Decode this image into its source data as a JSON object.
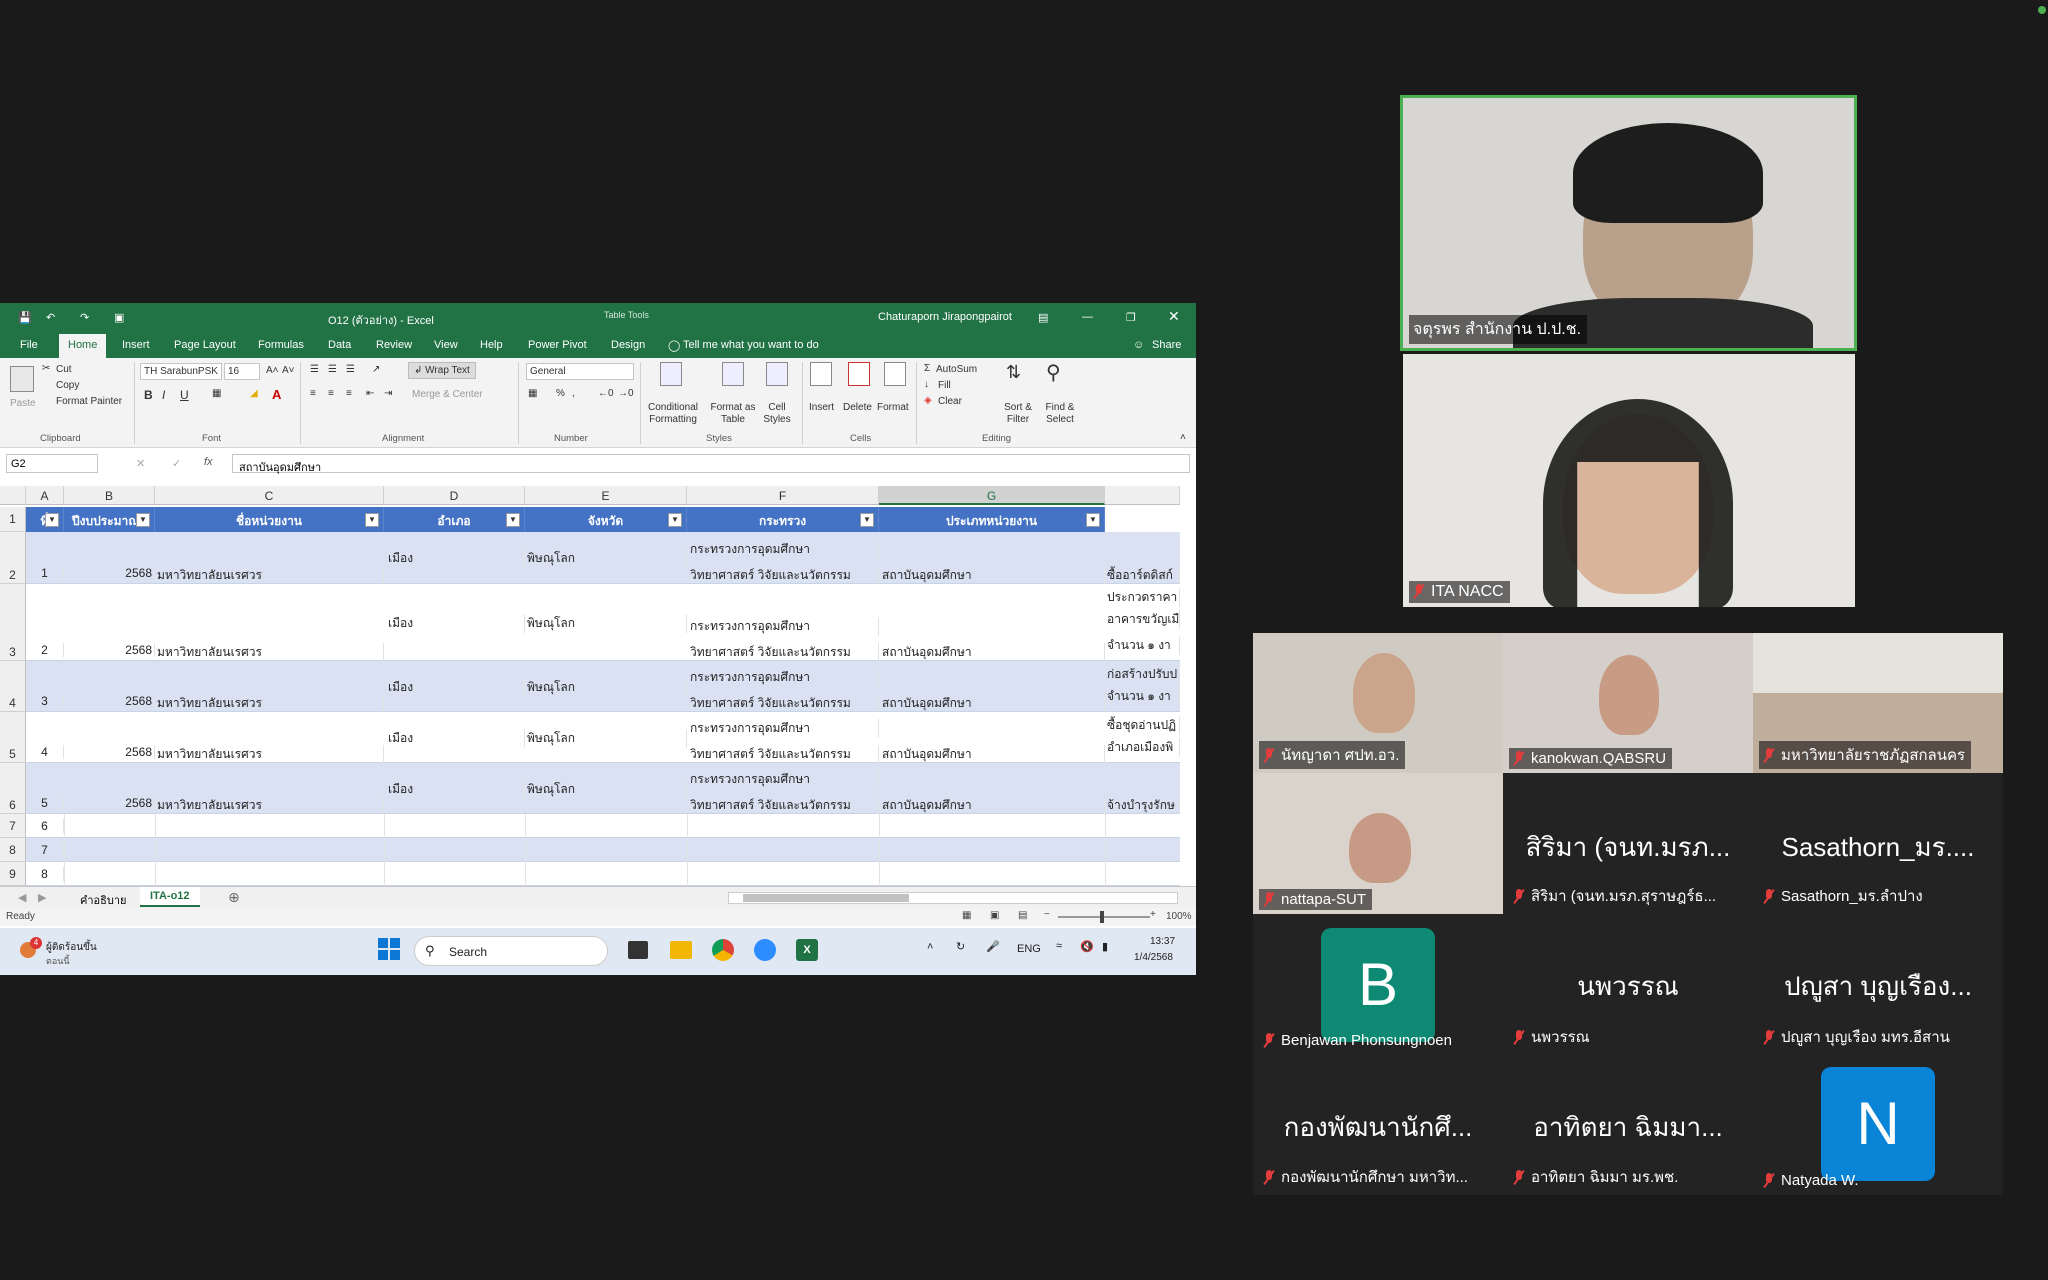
{
  "excel": {
    "title": "O12 (ตัวอย่าง) - Excel",
    "table_tools": "Table Tools",
    "user": "Chaturaporn Jirapongpairot",
    "tabs": [
      "File",
      "Home",
      "Insert",
      "Page Layout",
      "Formulas",
      "Data",
      "Review",
      "View",
      "Help",
      "Power Pivot",
      "Design"
    ],
    "tell_me": "Tell me what you want to do",
    "share": "Share",
    "ribbon": {
      "paste": "Paste",
      "cut": "Cut",
      "copy": "Copy",
      "format_painter": "Format Painter",
      "clipboard": "Clipboard",
      "font_name": "TH SarabunPSK",
      "font_size": "16",
      "font": "Font",
      "wrap_text": "Wrap Text",
      "merge_center": "Merge & Center",
      "alignment": "Alignment",
      "number_format": "General",
      "number": "Number",
      "conditional_formatting": "Conditional Formatting",
      "format_as_table": "Format as Table",
      "cell_styles": "Cell Styles",
      "styles": "Styles",
      "insert": "Insert",
      "delete": "Delete",
      "format": "Format",
      "cells": "Cells",
      "autosum": "AutoSum",
      "fill": "Fill",
      "clear": "Clear",
      "sort_filter": "Sort & Filter",
      "find_select": "Find & Select",
      "editing": "Editing"
    },
    "name_box": "G2",
    "formula": "สถาบันอุดมศึกษา",
    "columns": [
      "A",
      "B",
      "C",
      "D",
      "E",
      "F",
      "G"
    ],
    "headers": [
      "ที่",
      "ปีงบประมาณ",
      "ชื่อหน่วยงาน",
      "อำเภอ",
      "จังหวัด",
      "กระทรวง",
      "ประเภทหน่วยงาน"
    ],
    "rows": [
      {
        "rownum": "2",
        "no": "1",
        "year": "2568",
        "org": "มหาวิทยาลัยนเรศวร",
        "district": "เมือง",
        "province": "พิษณุโลก",
        "ministry1": "กระทรวงการอุดมศึกษา",
        "ministry2": "วิทยาศาสตร์ วิจัยและนวัตกรรม",
        "type": "สถาบันอุดมศึกษา",
        "h1": "ซื้ออาร์ตดิสก์",
        "h2": ""
      },
      {
        "rownum": "3",
        "no": "2",
        "year": "2568",
        "org": "มหาวิทยาลัยนเรศวร",
        "district": "เมือง",
        "province": "พิษณุโลก",
        "ministry1": "กระทรวงการอุดมศึกษา",
        "ministry2": "วิทยาศาสตร์ วิจัยและนวัตกรรม",
        "type": "สถาบันอุดมศึกษา",
        "h1": "ประกวดราคา",
        "h2": "อาคารขวัญเมื"
      },
      {
        "rownum": "4",
        "no": "3",
        "year": "2568",
        "org": "มหาวิทยาลัยนเรศวร",
        "district": "เมือง",
        "province": "พิษณุโลก",
        "ministry1": "กระทรวงการอุดมศึกษา",
        "ministry2": "วิทยาศาสตร์ วิจัยและนวัตกรรม",
        "type": "สถาบันอุดมศึกษา",
        "h1": "ก่อสร้างปรับป",
        "h2": "จำนวน ๑ งา"
      },
      {
        "rownum": "5",
        "no": "4",
        "year": "2568",
        "org": "มหาวิทยาลัยนเรศวร",
        "district": "เมือง",
        "province": "พิษณุโลก",
        "ministry1": "กระทรวงการอุดมศึกษา",
        "ministry2": "วิทยาศาสตร์ วิจัยและนวัตกรรม",
        "type": "สถาบันอุดมศึกษา",
        "h1": "ซื้อชุดอ่านปฏิ",
        "h2": "อำเภอเมืองพิ"
      },
      {
        "rownum": "6",
        "no": "5",
        "year": "2568",
        "org": "มหาวิทยาลัยนเรศวร",
        "district": "เมือง",
        "province": "พิษณุโลก",
        "ministry1": "กระทรวงการอุดมศึกษา",
        "ministry2": "วิทยาศาสตร์ วิจัยและนวัตกรรม",
        "type": "สถาบันอุดมศึกษา",
        "h1": "จ้างบำรุงรักษ",
        "h2": ""
      }
    ],
    "row3_extra": "จำนวน ๑ งา",
    "empty_rows": [
      {
        "rownum": "7",
        "no": "6"
      },
      {
        "rownum": "8",
        "no": "7"
      },
      {
        "rownum": "9",
        "no": "8"
      }
    ],
    "sheets": [
      "คำอธิบาย",
      "ITA-o12"
    ],
    "active_sheet": "ITA-o12",
    "status": "Ready",
    "zoom": "100%",
    "taskbar": {
      "weather": "ผู้ติดร้อนขึ้น",
      "weather_sub": "ตอนนี้",
      "weather_badge": "4",
      "search": "Search",
      "lang": "ENG",
      "time": "13:37",
      "date": "1/4/2568"
    }
  },
  "participants": [
    {
      "name": "จตุรพร สำนักงาน ป.ป.ช.",
      "muted": false,
      "active": true
    },
    {
      "name": "ITA NACC",
      "muted": true
    },
    {
      "name": "นัทญาดา ศปท.อว.",
      "muted": true
    },
    {
      "name": "kanokwan.QABSRU",
      "muted": true
    },
    {
      "name": "มหาวิทยาลัยราชภัฏสกลนคร",
      "muted": true
    },
    {
      "name": "nattapa-SUT",
      "muted": true
    },
    {
      "name": "สิริมา (จนท.มรภ.สุราษฎร์ธ...",
      "display": "สิริมา (จนท.มรภ...",
      "muted": true
    },
    {
      "name": "Sasathorn_มร.ลำปาง",
      "display": "Sasathorn_มร....",
      "muted": true
    },
    {
      "name": "Benjawan Phonsungnoen",
      "initial": "B",
      "muted": true
    },
    {
      "name": "นพวรรณ",
      "display": "นพวรรณ",
      "muted": true
    },
    {
      "name": "ปญูสา บุญเรือง มทร.อีสาน",
      "display": "ปญูสา บุญเรือง...",
      "muted": true
    },
    {
      "name": "กองพัฒนานักศึกษา มหาวิท...",
      "display": "กองพัฒนานักศึ...",
      "muted": true
    },
    {
      "name": "อาทิตยา ฉิมมา มร.พช.",
      "display": "อาทิตยา ฉิมมา...",
      "muted": true
    },
    {
      "name": "Natyada W.",
      "initial": "N",
      "muted": true
    }
  ],
  "colors": {
    "excel_green": "#217346",
    "table_header": "#4472c4",
    "band": "#d9e1f2",
    "active_speaker": "#4caf50",
    "muted": "#e23c3c",
    "avatar_b": "#0e8a74",
    "avatar_n": "#0a84d6"
  }
}
